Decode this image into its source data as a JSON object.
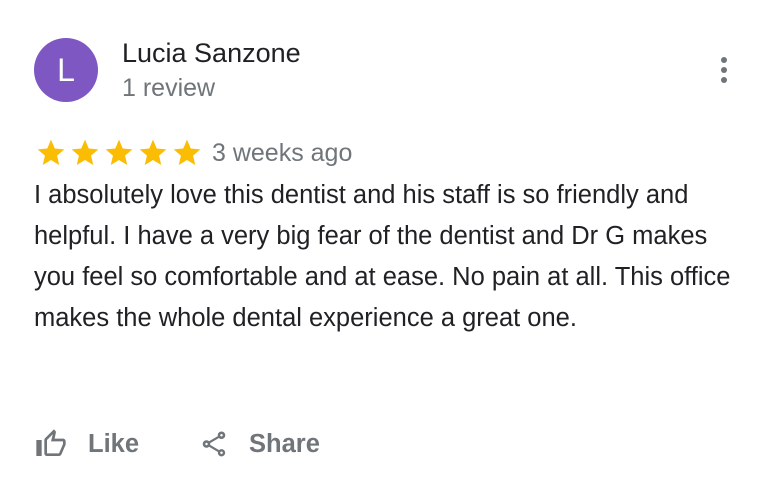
{
  "reviewer": {
    "initial": "L",
    "name": "Lucia Sanzone",
    "review_count": "1 review",
    "avatar_color": "#7e57c2"
  },
  "more_menu": {
    "icon": "more-vert-icon"
  },
  "review": {
    "rating": 5,
    "max_rating": 5,
    "star_color": "#fbbc04",
    "date": "3 weeks ago",
    "text": "I absolutely love this dentist and his staff is so friendly and helpful. I have a very big fear of the dentist and Dr G makes you feel so comfortable and at ease. No pain at all. This office makes the whole dental experience a great one."
  },
  "actions": {
    "like_label": "Like",
    "like_icon": "thumbs-up-icon",
    "share_label": "Share",
    "share_icon": "share-icon"
  },
  "colors": {
    "primary_text": "#202124",
    "secondary_text": "#70757a"
  }
}
